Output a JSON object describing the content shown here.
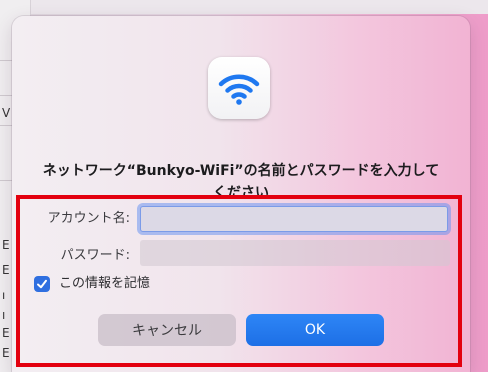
{
  "background": {
    "glyphs": [
      "V",
      "E",
      "E",
      "ו",
      "ı",
      "E",
      "E"
    ]
  },
  "dialog": {
    "icon": "wifi-icon",
    "title_line1": "ネットワーク“Bunkyo-WiFi”の名前とパスワードを入力して",
    "title_line2": "ください",
    "account_label": "アカウント名:",
    "account_value": "",
    "password_label": "パスワード:",
    "password_value": "",
    "remember_label": "この情報を記憶",
    "remember_checked": true,
    "cancel_label": "キャンセル",
    "ok_label": "OK"
  },
  "colors": {
    "accent": "#1d6fe6",
    "highlight": "#e3000f"
  }
}
